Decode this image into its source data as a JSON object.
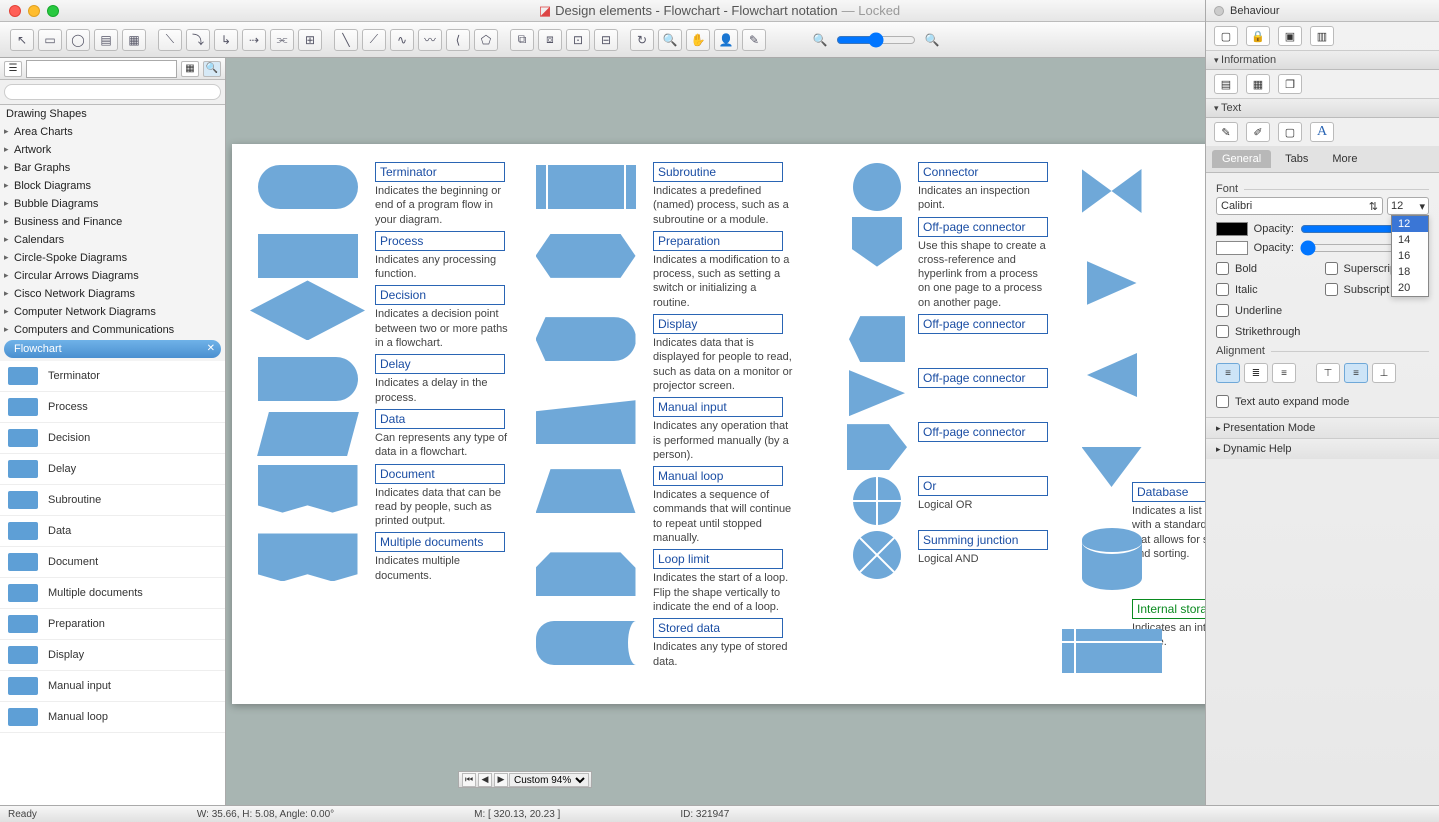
{
  "window": {
    "title": "Design elements - Flowchart - Flowchart notation",
    "locked": "— Locked"
  },
  "sidebar": {
    "heading": "Drawing Shapes",
    "tree": [
      "Area Charts",
      "Artwork",
      "Bar Graphs",
      "Block Diagrams",
      "Bubble Diagrams",
      "Business and Finance",
      "Calendars",
      "Circle-Spoke Diagrams",
      "Circular Arrows Diagrams",
      "Cisco Network Diagrams",
      "Computer Network Diagrams",
      "Computers and Communications"
    ],
    "selected": "Flowchart",
    "shapes": [
      "Terminator",
      "Process",
      "Decision",
      "Delay",
      "Subroutine",
      "Data",
      "Document",
      "Multiple documents",
      "Preparation",
      "Display",
      "Manual input",
      "Manual loop"
    ]
  },
  "canvas": {
    "col1": [
      {
        "label": "Terminator",
        "desc": "Indicates the beginning or end of a program flow in your diagram."
      },
      {
        "label": "Process",
        "desc": "Indicates any processing function."
      },
      {
        "label": "Decision",
        "desc": "Indicates a decision point between two or more paths in a flowchart."
      },
      {
        "label": "Delay",
        "desc": "Indicates a delay in the process."
      },
      {
        "label": "Data",
        "desc": "Can represents any type of data in a flowchart."
      },
      {
        "label": "Document",
        "desc": "Indicates data that can be read by people, such as printed output."
      },
      {
        "label": "Multiple documents",
        "desc": "Indicates multiple documents."
      }
    ],
    "col2": [
      {
        "label": "Subroutine",
        "desc": "Indicates a predefined (named) process, such as a subroutine or a module."
      },
      {
        "label": "Preparation",
        "desc": "Indicates a modification to a process, such as setting a switch or initializing a routine."
      },
      {
        "label": "Display",
        "desc": "Indicates data that is displayed for people to read, such as data on a monitor or projector screen."
      },
      {
        "label": "Manual input",
        "desc": "Indicates any operation that is performed manually (by a person)."
      },
      {
        "label": "Manual loop",
        "desc": "Indicates a sequence of commands that will continue to repeat until stopped manually."
      },
      {
        "label": "Loop limit",
        "desc": "Indicates the start of a loop. Flip the shape vertically to indicate the end of a loop."
      },
      {
        "label": "Stored data",
        "desc": "Indicates any type of stored data."
      }
    ],
    "col3": [
      {
        "label": "Connector",
        "desc": "Indicates an inspection point."
      },
      {
        "label": "Off-page connector",
        "desc": "Use this shape to create a cross-reference and hyperlink from a process on one page to a process on another page."
      },
      {
        "label": "Off-page connector",
        "desc": ""
      },
      {
        "label": "Off-page connector",
        "desc": ""
      },
      {
        "label": "Off-page connector",
        "desc": ""
      },
      {
        "label": "Or",
        "desc": "Logical OR"
      },
      {
        "label": "Summing junction",
        "desc": "Logical AND"
      }
    ],
    "col4": [
      {
        "label": "Database",
        "desc": "Indicates a list of information with a standard structure that allows for searching and sorting."
      },
      {
        "label": "Internal storage",
        "desc": "Indicates an internal storage device.",
        "green": true
      }
    ]
  },
  "right": {
    "behaviour": "Behaviour",
    "information": "Information",
    "text": "Text",
    "tabs": {
      "general": "General",
      "tabs": "Tabs",
      "more": "More"
    },
    "font_label": "Font",
    "font_name": "Calibri",
    "font_size": "12",
    "size_options": [
      "12",
      "14",
      "16",
      "18",
      "20"
    ],
    "opacity": "Opacity:",
    "bold": "Bold",
    "italic": "Italic",
    "underline": "Underline",
    "strike": "Strikethrough",
    "superscript": "Superscript",
    "subscript": "Subscript",
    "alignment": "Alignment",
    "autoexpand": "Text auto expand mode",
    "presentation": "Presentation Mode",
    "dynhelp": "Dynamic Help"
  },
  "status": {
    "ready": "Ready",
    "dims": "W: 35.66,  H: 5.08,  Angle: 0.00°",
    "mouse": "M: [ 320.13, 20.23 ]",
    "id": "ID: 321947",
    "zoom": "Custom 94%"
  }
}
